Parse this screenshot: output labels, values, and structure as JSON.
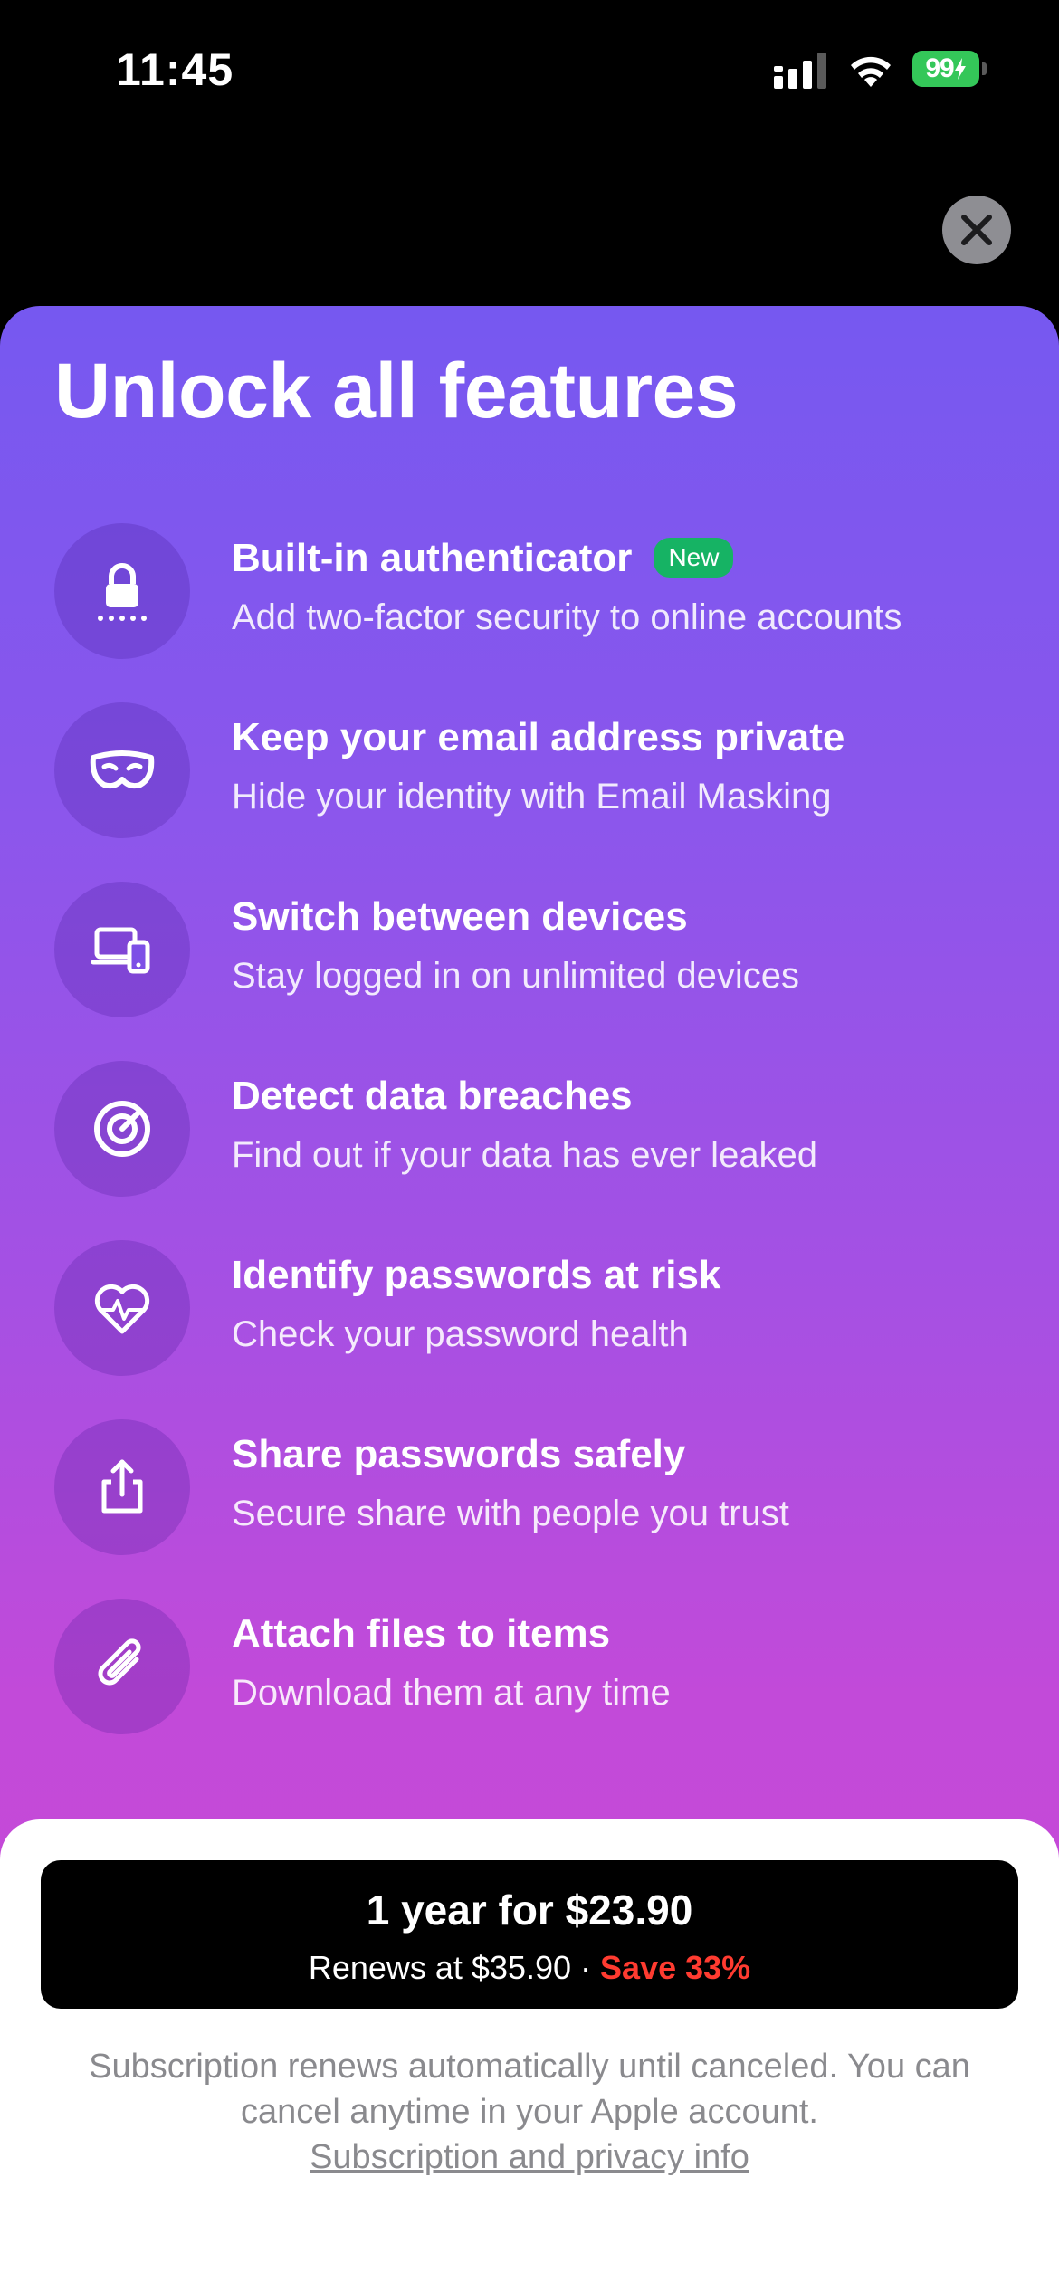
{
  "status_bar": {
    "time": "11:45",
    "battery": "99"
  },
  "paywall": {
    "title": "Unlock all features",
    "close_icon": "close-icon",
    "features": [
      {
        "icon": "lock-icon",
        "title": "Built-in authenticator",
        "badge": "New",
        "description": "Add two-factor security to online accounts"
      },
      {
        "icon": "mask-icon",
        "title": "Keep your email address private",
        "description": "Hide your identity with Email Masking"
      },
      {
        "icon": "devices-icon",
        "title": "Switch between devices",
        "description": "Stay logged in on unlimited devices"
      },
      {
        "icon": "target-icon",
        "title": "Detect data breaches",
        "description": "Find out if your data has ever leaked"
      },
      {
        "icon": "heart-pulse-icon",
        "title": "Identify passwords at risk",
        "description": "Check your password health"
      },
      {
        "icon": "share-icon",
        "title": "Share passwords safely",
        "description": "Secure share with people you trust"
      },
      {
        "icon": "paperclip-icon",
        "title": "Attach files to items",
        "description": "Download them at any time"
      }
    ],
    "purchase": {
      "main": "1 year for $23.90",
      "renews": "Renews at $35.90 · ",
      "save": "Save 33%"
    },
    "legal": {
      "text": "Subscription renews automatically until canceled. You can cancel anytime in your Apple account.",
      "link": "Subscription and privacy info"
    }
  },
  "colors": {
    "gradient_top": "#7658f0",
    "gradient_bottom": "#cb47d6",
    "badge_green": "#16b364",
    "save_red": "#ff3b30"
  }
}
